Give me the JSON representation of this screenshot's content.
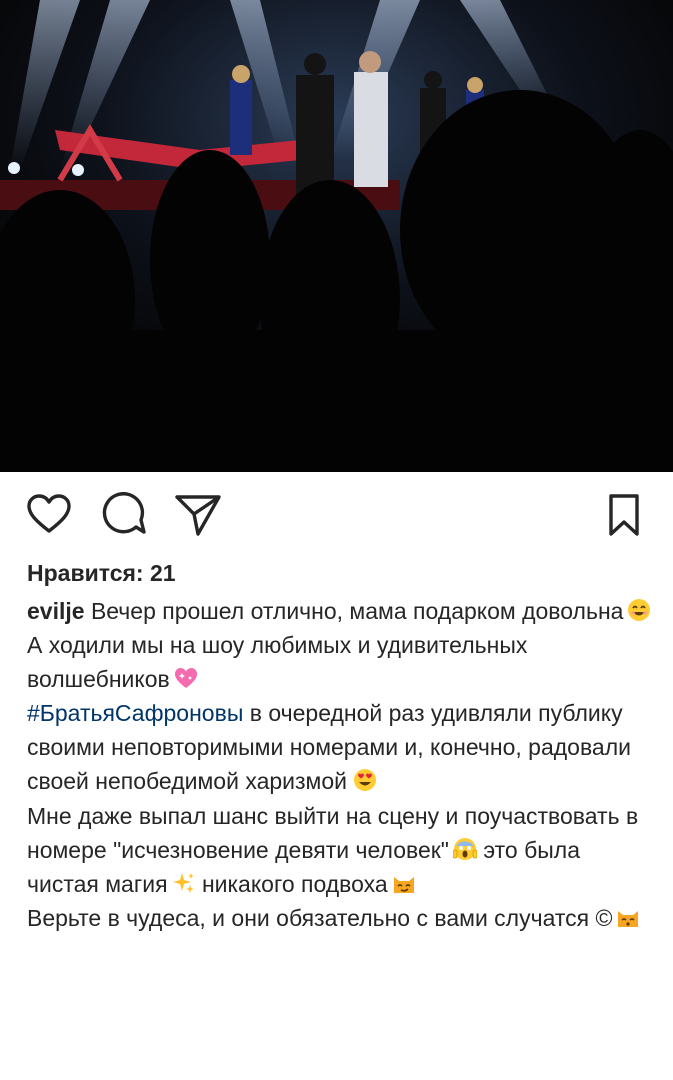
{
  "post": {
    "likes_text": "Нравится: 21",
    "username": "evilje",
    "caption": {
      "line1": "Вечер прошел отлично, мама подарком довольна",
      "line2": "А ходили мы на шоу любимых и удивительных волшебников",
      "hashtag": "#БратьяСафроновы",
      "line3": "в очередной раз удивляли публику своими неповторимыми номерами и, конечно, радовали своей непобедимой харизмой",
      "line4a": "Мне даже выпал шанс выйти на сцену и поучаствовать в номере \"исчезновение девяти человек\"",
      "line4b": "это была чистая магия",
      "line4c": "никакого подвоха",
      "line5": "Верьте в чудеса, и они обязательно с вами случатся ©"
    },
    "emojis": [
      "smiling-face-emoji",
      "sparkling-heart-emoji",
      "heart-eyes-emoji",
      "screaming-face-emoji",
      "sparkles-emoji",
      "smirking-cat-emoji",
      "kissing-cat-emoji"
    ]
  },
  "actions": {
    "icons": [
      "heart-icon",
      "comment-icon",
      "share-icon",
      "bookmark-icon"
    ]
  },
  "colors": {
    "text": "#262626",
    "hashtag": "#003569",
    "icon_stroke": "#262626"
  }
}
